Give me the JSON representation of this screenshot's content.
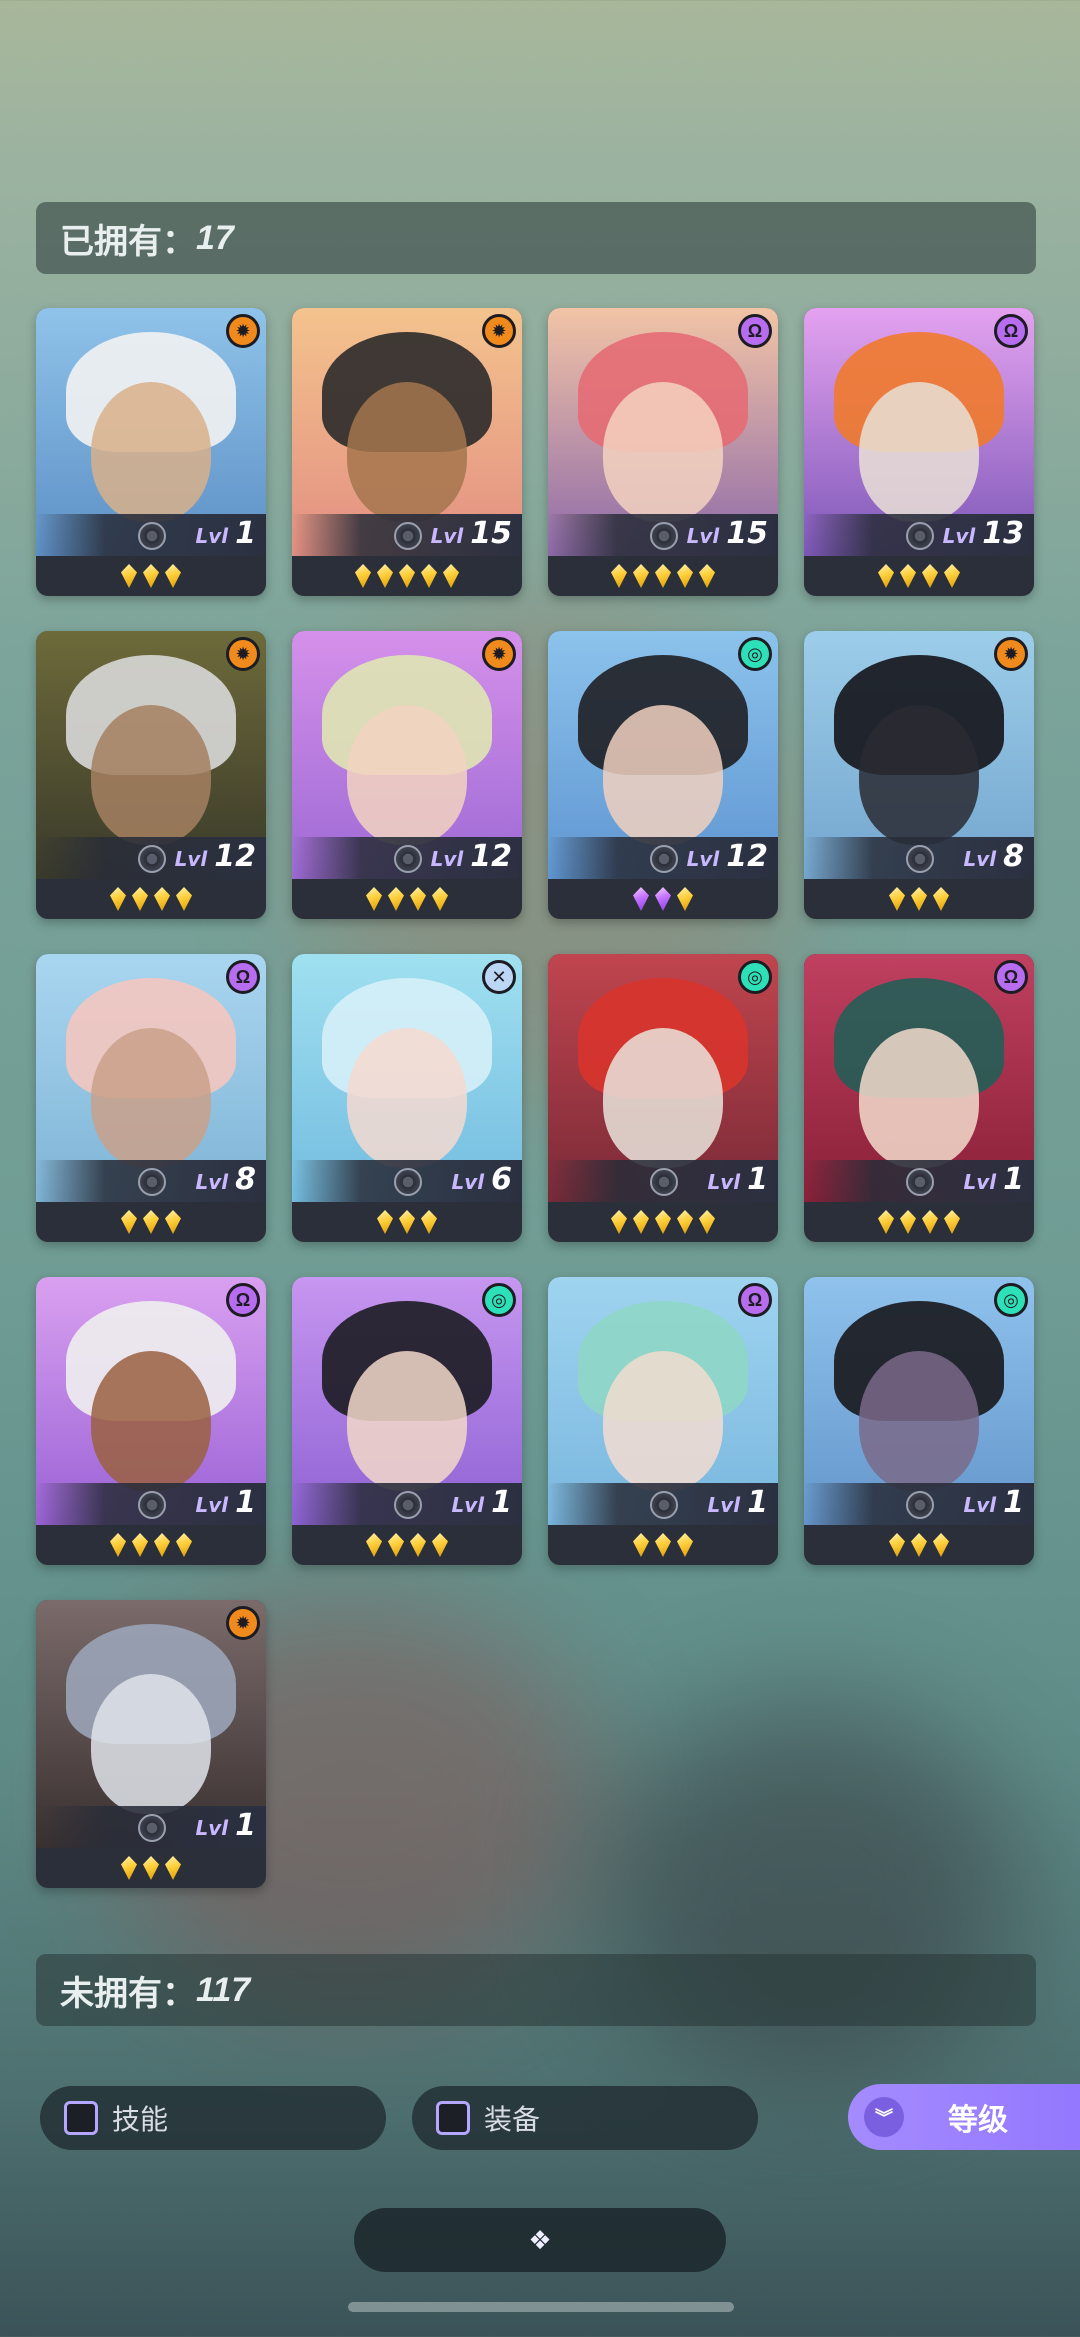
{
  "owned_header": {
    "label": "已拥有：",
    "count": "17"
  },
  "unowned_header": {
    "label": "未拥有：",
    "count": "117"
  },
  "lvl_prefix": "Lvl",
  "cards": [
    {
      "level": "1",
      "stars": 3,
      "star_color": "gold",
      "element": "sun",
      "elem_color": "#f08a1c",
      "bg": [
        "#8fc3e9",
        "#5d90c6"
      ],
      "hair": "#f2f2f2",
      "skin": "#d8b08a"
    },
    {
      "level": "15",
      "stars": 5,
      "star_color": "gold",
      "element": "sun",
      "elem_color": "#f08a1c",
      "bg": [
        "#f4c38d",
        "#e38f82"
      ],
      "hair": "#2b2a2a",
      "skin": "#a5764e"
    },
    {
      "level": "15",
      "stars": 5,
      "star_color": "gold",
      "element": "omega",
      "elem_color": "#b86df0",
      "bg": [
        "#f2c4a6",
        "#8e6aa8"
      ],
      "hair": "#e46b74",
      "skin": "#f3d2c0"
    },
    {
      "level": "13",
      "stars": 4,
      "star_color": "gold",
      "element": "omega",
      "elem_color": "#b86df0",
      "bg": [
        "#e4a2f0",
        "#7d58b8"
      ],
      "hair": "#f07a2c",
      "skin": "#e9e1d6"
    },
    {
      "level": "12",
      "stars": 4,
      "star_color": "gold",
      "element": "sun",
      "elem_color": "#f08a1c",
      "bg": [
        "#6d6a3a",
        "#3a3a2a"
      ],
      "hair": "#d8d8d8",
      "skin": "#a58060"
    },
    {
      "level": "12",
      "stars": 4,
      "star_color": "gold",
      "element": "sun",
      "elem_color": "#f08a1c",
      "bg": [
        "#d590ea",
        "#9d6ad5"
      ],
      "hair": "#dfe6b4",
      "skin": "#f2d4c0"
    },
    {
      "level": "12",
      "stars": 3,
      "star_color": "purple",
      "element": "swirl",
      "elem_color": "#2ee0b8",
      "bg": [
        "#8cc3ec",
        "#5f96d2"
      ],
      "hair": "#1f1f24",
      "skin": "#f0d0be"
    },
    {
      "level": "8",
      "stars": 3,
      "star_color": "gold",
      "element": "sun",
      "elem_color": "#f08a1c",
      "bg": [
        "#9ccde9",
        "#74a6cf"
      ],
      "hair": "#14141a",
      "skin": "#2a2a32"
    },
    {
      "level": "8",
      "stars": 3,
      "star_color": "gold",
      "element": "omega",
      "elem_color": "#b86df0",
      "bg": [
        "#a9d6f0",
        "#7fb4d6"
      ],
      "hair": "#f4c6c0",
      "skin": "#caa08a"
    },
    {
      "level": "6",
      "stars": 3,
      "star_color": "gold",
      "element": "cross",
      "elem_color": "#bcd7f5",
      "bg": [
        "#9fe0f0",
        "#74bce0"
      ],
      "hair": "#d6f0f8",
      "skin": "#f4d9d0"
    },
    {
      "level": "1",
      "stars": 5,
      "star_color": "gold",
      "element": "swirl",
      "elem_color": "#2ee0b8",
      "bg": [
        "#c0454e",
        "#7a2a38"
      ],
      "hair": "#d8342c",
      "skin": "#e9e4dc"
    },
    {
      "level": "1",
      "stars": 4,
      "star_color": "gold",
      "element": "omega",
      "elem_color": "#b86df0",
      "bg": [
        "#c04060",
        "#8a2038"
      ],
      "hair": "#245e58",
      "skin": "#f2dccd"
    },
    {
      "level": "1",
      "stars": 4,
      "star_color": "gold",
      "element": "omega",
      "elem_color": "#b86df0",
      "bg": [
        "#d9a0f0",
        "#9a62d6"
      ],
      "hair": "#eeeeee",
      "skin": "#9a6040"
    },
    {
      "level": "1",
      "stars": 4,
      "star_color": "gold",
      "element": "swirl",
      "elem_color": "#2ee0b8",
      "bg": [
        "#c796f0",
        "#8e62d4"
      ],
      "hair": "#1c1c22",
      "skin": "#f2d8c8"
    },
    {
      "level": "1",
      "stars": 3,
      "star_color": "gold",
      "element": "omega",
      "elem_color": "#b86df0",
      "bg": [
        "#9fd4f0",
        "#79b6de"
      ],
      "hair": "#8fd6c6",
      "skin": "#f3dcd0"
    },
    {
      "level": "1",
      "stars": 3,
      "star_color": "gold",
      "element": "swirl",
      "elem_color": "#2ee0b8",
      "bg": [
        "#8fc2ec",
        "#6496cc"
      ],
      "hair": "#17171c",
      "skin": "#7a6a8a"
    },
    {
      "level": "1",
      "stars": 3,
      "star_color": "gold",
      "element": "sun",
      "elem_color": "#f08a1c",
      "bg": [
        "#7b6b6b",
        "#3a3030"
      ],
      "hair": "#9aa4b8",
      "skin": "#dfe4ea"
    }
  ],
  "filters": {
    "skill_label": "技能",
    "equip_label": "装备"
  },
  "sort": {
    "label": "等级",
    "icon": "chevron-double-down-icon"
  },
  "bottom_bar": {
    "icon": "diamonds-icon",
    "glyph": "❖"
  },
  "element_glyphs": {
    "sun": "✹",
    "omega": "Ω",
    "swirl": "◎",
    "cross": "✕"
  }
}
